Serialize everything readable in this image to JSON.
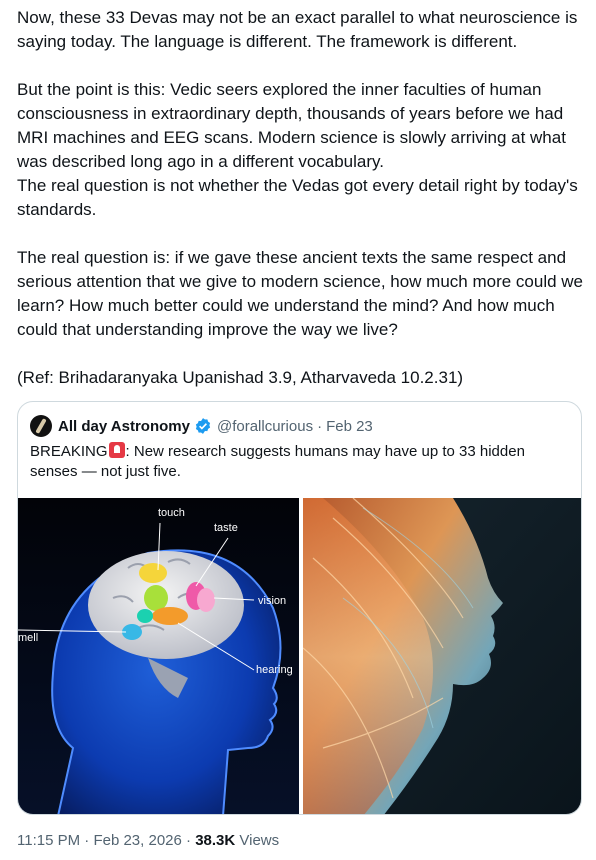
{
  "tweet": {
    "paragraphs": [
      "Now, these 33 Devas may not be an exact parallel to what neuroscience is saying today. The language is different. The framework is different.",
      "But the point is this: Vedic seers explored the inner faculties of human consciousness in extraordinary depth, thousands of years before we had MRI machines and EEG scans. Modern science is slowly arriving at what was described long ago in a different vocabulary.",
      "The real question is not whether the Vedas got every detail right by today's standards.",
      "The real question is: if we gave these ancient texts the same respect and serious attention that we give to modern science, how much more could we learn? How much better could we understand the mind? And how much could that understanding improve the way we live?",
      "(Ref: Brihadaranyaka Upanishad 3.9, Atharvaveda 10.2.31)"
    ]
  },
  "quote": {
    "name": "All day Astronomy",
    "handle": "@forallcurious",
    "separator": "·",
    "date": "Feb 23",
    "text_prefix": "BREAKING",
    "text_body": ": New research suggests humans may have up to 33 hidden senses — not just five.",
    "image_labels": {
      "touch": "touch",
      "taste": "taste",
      "vision": "vision",
      "smell": "mell",
      "hearing": "hearing"
    }
  },
  "meta": {
    "time": "11:15 PM",
    "separator": "·",
    "date": "Feb 23, 2026",
    "separator2": "·",
    "views_count": "38.3K",
    "views_label": "Views"
  },
  "colors": {
    "text": "#0f1419",
    "secondary": "#536471",
    "border": "#cfd9de",
    "verified": "#1d9bf0"
  },
  "icons": [
    "verified-badge-icon",
    "siren-emoji-icon",
    "avatar-icon"
  ]
}
